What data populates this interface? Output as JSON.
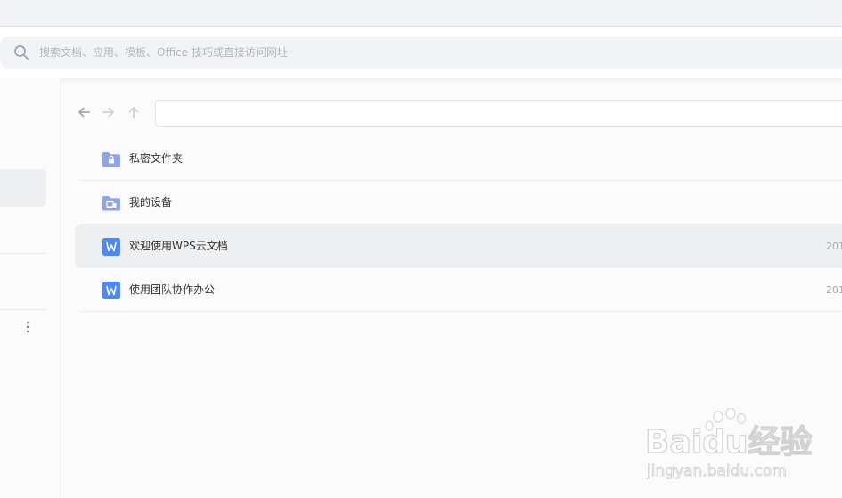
{
  "search": {
    "placeholder": "搜索文档、应用、模板、Office 技巧或直接访问网址"
  },
  "files": [
    {
      "name": "私密文件夹",
      "date": "",
      "icon": "lock-folder-icon",
      "selected": false
    },
    {
      "name": "我的设备",
      "date": "",
      "icon": "device-folder-icon",
      "selected": false
    },
    {
      "name": "欢迎使用WPS云文档",
      "date": "201",
      "icon": "wps-writer-doc-icon",
      "selected": true
    },
    {
      "name": "使用团队协作办公",
      "date": "201",
      "icon": "wps-writer-doc-icon",
      "selected": false
    }
  ],
  "watermark": {
    "brand": "Baidu经验",
    "url": "jingyan.baidu.com"
  },
  "colors": {
    "folder": "#8fa4e6",
    "doc": "#4c89f6",
    "selection": "#eeeff1"
  }
}
